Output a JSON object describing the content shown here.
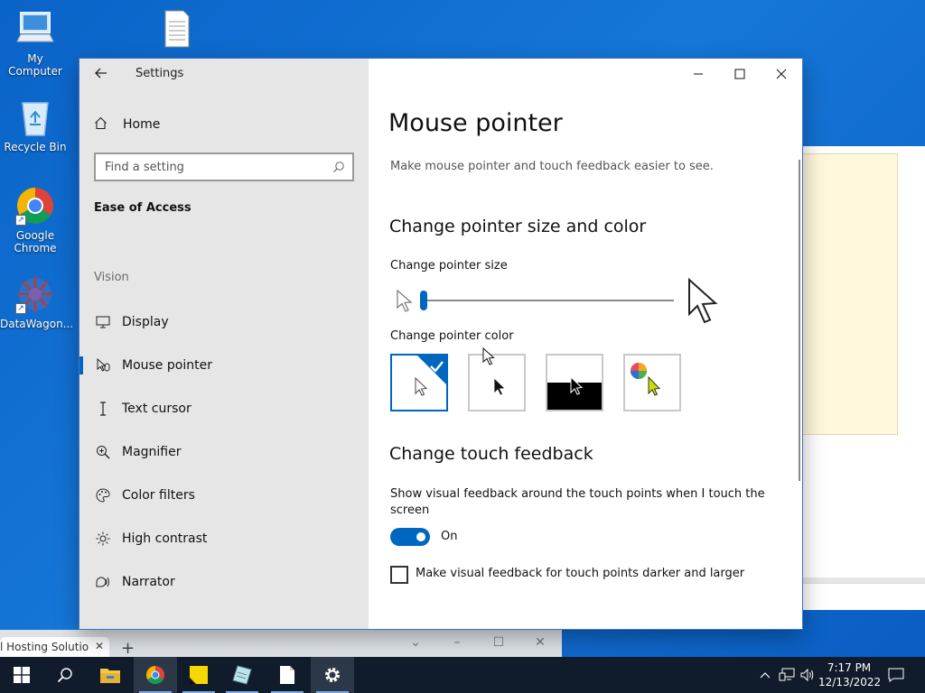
{
  "desktop": {
    "icons": [
      {
        "label": "My Computer"
      },
      {
        "label": "Recycle Bin"
      },
      {
        "label": "Google Chrome"
      },
      {
        "label": "DataWagon..."
      }
    ]
  },
  "browser": {
    "tab_label": "l Hosting Solutio",
    "tab_close": "✕",
    "new_tab": "+"
  },
  "settings": {
    "window_title": "Settings",
    "home_label": "Home",
    "search_placeholder": "Find a setting",
    "section": "Ease of Access",
    "group_label": "Vision",
    "nav_items": [
      {
        "label": "Display",
        "icon": "monitor-icon"
      },
      {
        "label": "Mouse pointer",
        "icon": "mouse-pointer-icon"
      },
      {
        "label": "Text cursor",
        "icon": "text-cursor-icon"
      },
      {
        "label": "Magnifier",
        "icon": "magnifier-icon"
      },
      {
        "label": "Color filters",
        "icon": "palette-icon"
      },
      {
        "label": "High contrast",
        "icon": "sun-icon"
      },
      {
        "label": "Narrator",
        "icon": "narrator-icon"
      }
    ],
    "active_nav": "Mouse pointer"
  },
  "content": {
    "title": "Mouse pointer",
    "description": "Make mouse pointer and touch feedback easier to see.",
    "size_color_heading": "Change pointer size and color",
    "size_label": "Change pointer size",
    "size_value": 1,
    "color_label": "Change pointer color",
    "color_options": [
      "white",
      "black",
      "inverted",
      "custom"
    ],
    "selected_color": "white",
    "touch_heading": "Change touch feedback",
    "touch_label_line1": "Show visual feedback around the touch points when I touch the",
    "touch_label_line2": "screen",
    "toggle_state": "On",
    "checkbox_label": "Make visual feedback for touch points darker and larger",
    "checkbox_checked": false
  },
  "taskbar": {
    "time": "7:17 PM",
    "date": "12/13/2022"
  },
  "colors": {
    "accent": "#0067c0",
    "sidebar_bg": "#e6e6e6",
    "taskbar_bg": "#101b2b"
  }
}
